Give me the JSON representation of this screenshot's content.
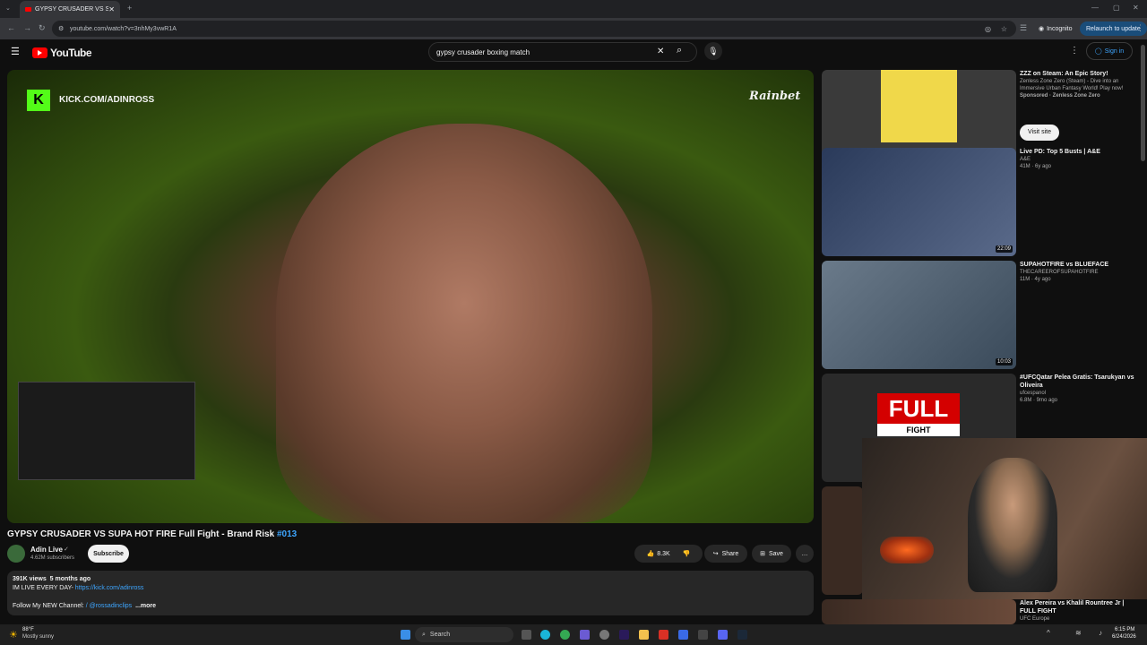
{
  "browser": {
    "tab_title": "GYPSY CRUSADER VS SUPA HOT F",
    "url": "youtube.com/watch?v=3nhMy3vwR1A",
    "incognito_label": "Incognito",
    "relaunch_label": "Relaunch to update"
  },
  "yt": {
    "logo_text": "YouTube",
    "search_value": "gypsy crusader boxing match",
    "sign_in": "Sign in"
  },
  "video": {
    "overlay_url": "KICK.COM/ADINROSS",
    "sponsor": "Rainbet",
    "title": "GYPSY CRUSADER VS SUPA HOT FIRE Full Fight - Brand Risk ",
    "title_tag": "#013"
  },
  "channel": {
    "name": "Adin Live",
    "subs": "4.62M subscribers",
    "subscribe": "Subscribe",
    "likes": "8.3K",
    "share": "Share",
    "save": "Save"
  },
  "desc": {
    "views": "391K views",
    "age": "5 months ago",
    "line1": "IM LIVE EVERY DAY- ",
    "link1": "https://kick.com/adinross",
    "line2": "Follow My NEW Channel: ",
    "link2": "/ @rossadinclips",
    "more": "...more"
  },
  "recs": [
    {
      "title": "ZZZ on Steam: An Epic Story!",
      "channel": "Zenless Zone Zero (Steam) - Dive into an Immersive Urban Fantasy World! Play now!",
      "stats": "Sponsored · Zenless Zone Zero",
      "button": "Visit site"
    },
    {
      "title": "Live PD: Top 5 Busts | A&E",
      "channel": "A&E",
      "stats": "41M · 6y ago",
      "duration": "22:09"
    },
    {
      "title": "SUPAHOTFIRE vs BLUEFACE",
      "channel": "THECAREEROFSUPAHOTFIRE",
      "stats": "11M · 4y ago",
      "duration": "10:03"
    },
    {
      "title": "#UFCQatar Pelea Gratis: Tsarukyan vs Oliveira",
      "channel": "ufcespanol",
      "stats": "6.8M · 9mo ago",
      "thumb_text1": "FULL",
      "thumb_text2": "FIGHT"
    },
    {
      "title": "Alex Pereira vs Khalil Rountree Jr | FULL FIGHT",
      "channel": "UFC Europe"
    }
  ],
  "taskbar": {
    "temp": "88°F",
    "weather": "Mostly sunny",
    "search": "Search",
    "time": "6:15 PM",
    "date": "6/24/2026"
  }
}
